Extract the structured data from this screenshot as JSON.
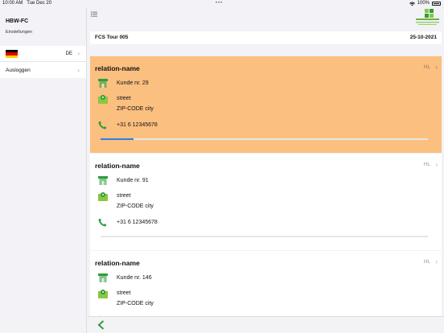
{
  "status_bar": {
    "time": "10:00 AM",
    "date": "Tue Dec 20",
    "battery": "100%"
  },
  "sidebar": {
    "title": "HBW-FC",
    "subtitle": "Einstellungen",
    "language": {
      "code": "DE",
      "flag": "germany-flag"
    },
    "logout_label": "Ausloggen"
  },
  "header": {
    "menu_icon": "list-icon",
    "logo": "flowerwatch-logo"
  },
  "tour": {
    "name": "FCS Tour 005",
    "date": "25-10-2021"
  },
  "cards": [
    {
      "relation": "relation-name",
      "code": "HL",
      "customer": "Kunde nr. 29",
      "street": "street",
      "city": "ZIP-CODE city",
      "phone": "+31 6 12345678",
      "progress": 0.1,
      "active": true
    },
    {
      "relation": "relation-name",
      "code": "HL",
      "customer": "Kunde nr. 91",
      "street": "street",
      "city": "ZIP-CODE city",
      "phone": "+31 6 12345678",
      "progress": 0,
      "active": false
    },
    {
      "relation": "relation-name",
      "code": "HL",
      "customer": "Kunde nr. 146",
      "street": "street",
      "city": "ZIP-CODE city",
      "phone": "",
      "progress": 0,
      "active": false
    }
  ],
  "colors": {
    "active_card": "#fbbf7f",
    "accent_green": "#2e9e3e",
    "progress_blue": "#2f7fe0",
    "back_green": "#2e9e3e"
  }
}
